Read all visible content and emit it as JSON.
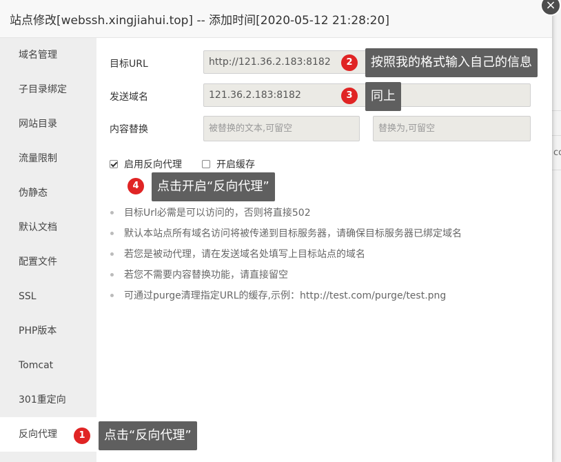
{
  "dialog": {
    "title": "站点修改[webssh.xingjiahui.top] -- 添加时间[2020-05-12 21:28:20]",
    "close_icon": "×"
  },
  "background": {
    "cut_text": "co"
  },
  "sidebar": {
    "items": [
      {
        "label": "域名管理"
      },
      {
        "label": "子目录绑定"
      },
      {
        "label": "网站目录"
      },
      {
        "label": "流量限制"
      },
      {
        "label": "伪静态"
      },
      {
        "label": "默认文档"
      },
      {
        "label": "配置文件"
      },
      {
        "label": "SSL"
      },
      {
        "label": "PHP版本"
      },
      {
        "label": "Tomcat"
      },
      {
        "label": "301重定向"
      },
      {
        "label": "反向代理"
      }
    ],
    "active": "反向代理"
  },
  "form": {
    "target_url": {
      "label": "目标URL",
      "value": "http://121.36.2.183:8182"
    },
    "send_domain": {
      "label": "发送域名",
      "value": "121.36.2.183:8182"
    },
    "content_replace": {
      "label": "内容替换",
      "from_placeholder": "被替换的文本,可留空",
      "to_placeholder": "替换为,可留空"
    },
    "enable_proxy": {
      "label": "启用反向代理",
      "checked": true
    },
    "enable_cache": {
      "label": "开启缓存",
      "checked": false
    }
  },
  "tips": [
    "目标Url必需是可以访问的，否则将直接502",
    "默认本站点所有域名访问将被传递到目标服务器，请确保目标服务器已绑定域名",
    "若您是被动代理，请在发送域名处填写上目标站点的域名",
    "若您不需要内容替换功能，请直接留空",
    "可通过purge清理指定URL的缓存,示例：http://test.com/purge/test.png"
  ],
  "annotations": [
    {
      "number": "1",
      "text": "点击“反向代理”"
    },
    {
      "number": "2",
      "text": "按照我的格式输入自己的信息"
    },
    {
      "number": "3",
      "text": "同上"
    },
    {
      "number": "4",
      "text": "点击开启“反向代理”"
    }
  ],
  "colors": {
    "badge": "#e02424",
    "callout_bg": "#5f5f5f",
    "sidebar_bg": "#eeeeee",
    "input_bg": "#ebeae5"
  }
}
